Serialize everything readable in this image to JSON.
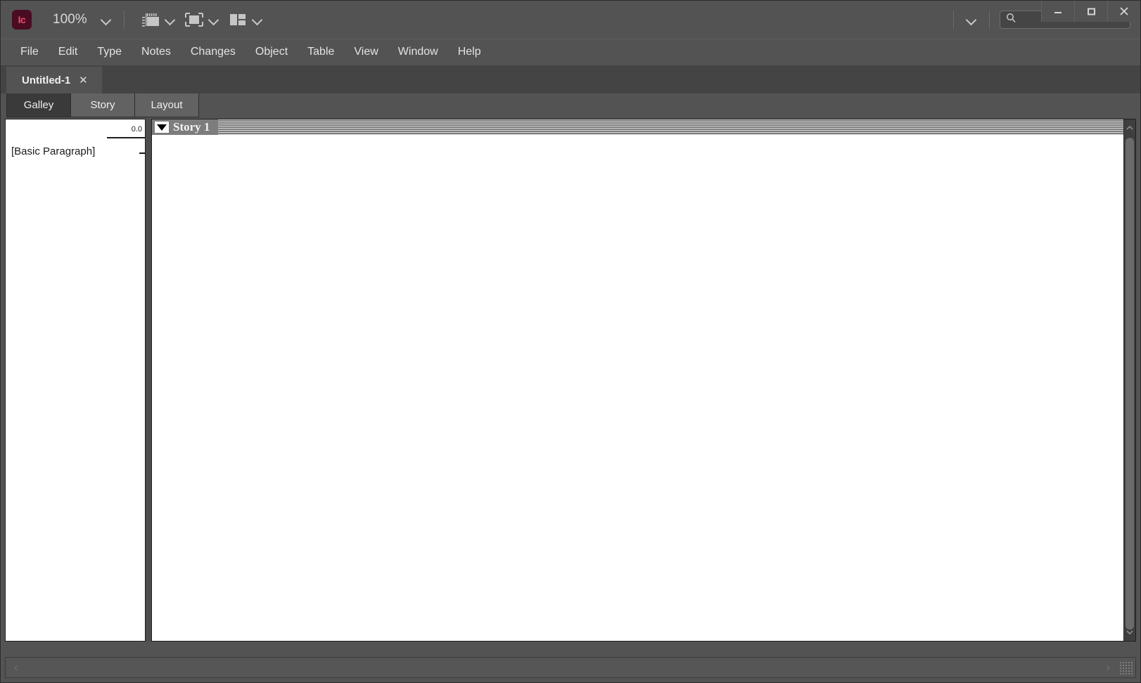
{
  "app": {
    "logo_text": "Ic",
    "zoom_level": "100%"
  },
  "toolbar": {
    "zoom_dropdown_icon": "chevron-down-icon",
    "screen_mode_icon": "screen-mode-icon",
    "screen_mode_dropdown_icon": "chevron-down-icon",
    "view_mode_icon": "view-mode-icon",
    "view_mode_dropdown_icon": "chevron-down-icon",
    "workspace_icon": "workspace-layout-icon",
    "workspace_dropdown_icon": "chevron-down-icon",
    "overflow_icon": "chevron-down-icon",
    "search_icon": "search-icon",
    "search_value": "",
    "search_placeholder": ""
  },
  "window_controls": {
    "minimize": "minimize-icon",
    "maximize": "maximize-icon",
    "close": "close-icon"
  },
  "menubar": {
    "items": [
      {
        "label": "File"
      },
      {
        "label": "Edit"
      },
      {
        "label": "Type"
      },
      {
        "label": "Notes"
      },
      {
        "label": "Changes"
      },
      {
        "label": "Object"
      },
      {
        "label": "Table"
      },
      {
        "label": "View"
      },
      {
        "label": "Window"
      },
      {
        "label": "Help"
      }
    ]
  },
  "document_tabs": {
    "tabs": [
      {
        "label": "Untitled-1",
        "close_label": "✕",
        "active": true
      }
    ]
  },
  "view_tabs": {
    "tabs": [
      {
        "label": "Galley",
        "active": true
      },
      {
        "label": "Story",
        "active": false
      },
      {
        "label": "Layout",
        "active": false
      }
    ]
  },
  "editor": {
    "styles_pane": {
      "line_count": "0.0",
      "paragraph_style": "[Basic Paragraph]"
    },
    "story_pane": {
      "story_title": "Story 1",
      "collapse_icon": "triangle-down-icon",
      "body_text": ""
    },
    "scrollbar": {
      "up_arrow": "chevron-up-icon",
      "down_arrow": "chevron-down-icon"
    }
  },
  "statusbar": {
    "left_arrow": "‹",
    "right_arrow": "›",
    "resize_grip": "resize-grip-icon"
  },
  "colors": {
    "app_background": "#535353",
    "panel_background": "#ffffff",
    "accent_logo": "#4a0c22",
    "accent_logo_text": "#f24b6a",
    "story_header": "#7d7d7d",
    "active_tab": "#3a3a3a"
  }
}
